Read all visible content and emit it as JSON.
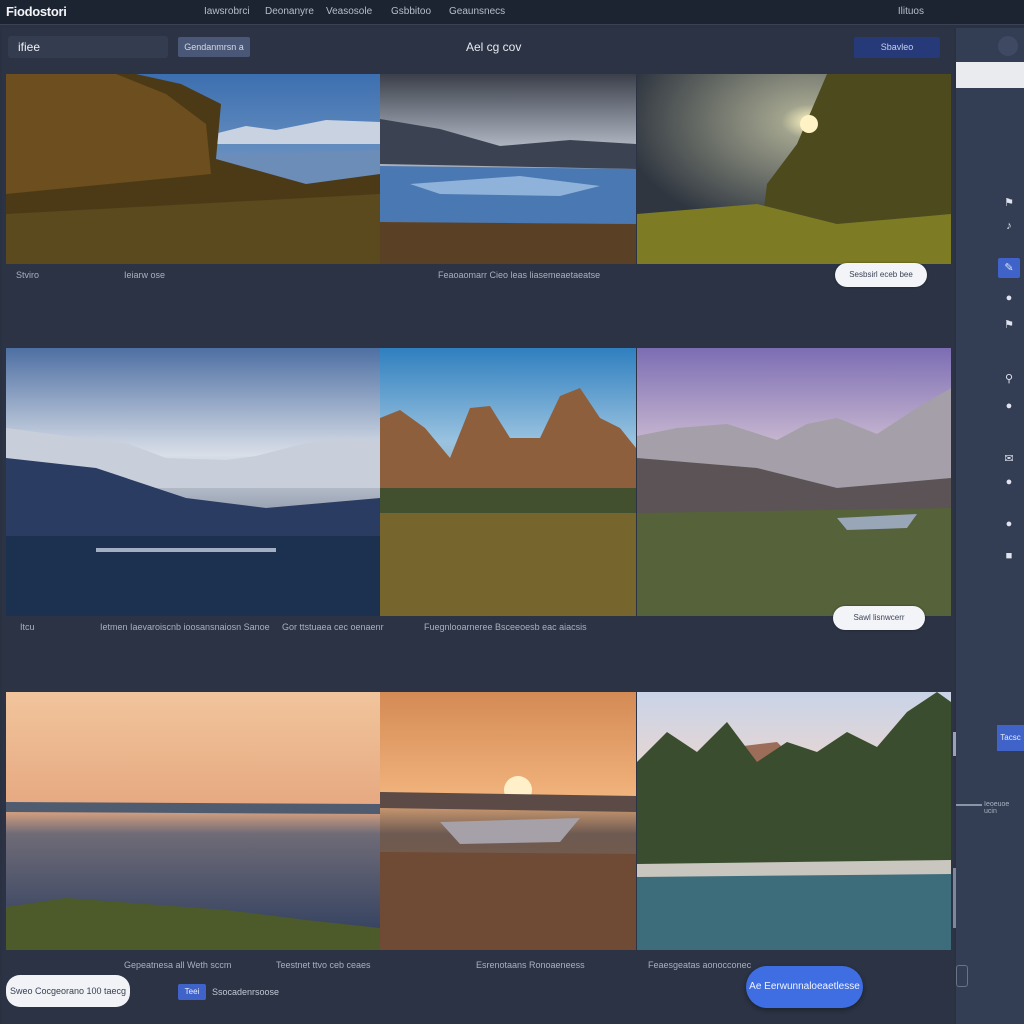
{
  "app": {
    "brand": "Fiodostori",
    "nav": [
      "Iawsrobrci",
      "Deonanyre",
      "Veasosole",
      "Gsbbitoo",
      "Geaunsnecs"
    ],
    "nav_right": "Ilituos"
  },
  "toolbar": {
    "search_value": "ifiee",
    "filter_label": "Gendanmrsn a",
    "title": "Ael cg cov",
    "primary_label": "Sbavleo"
  },
  "gallery": {
    "rows": [
      {
        "captions": [
          "Stviro",
          "Ieiarw ose",
          "Feaoaomarr Cieo leas liasemeaetaeatse"
        ],
        "pill": "Sesbsirl eceb bee"
      },
      {
        "captions": [
          "Itcu",
          "Ietmen Iaevaroiscnb ioosansnaiosn Sanoe",
          "Gor ttstuaea cec oenaenr",
          "Fuegnlooarneree Bsceeoesb eac aiacsis"
        ],
        "pill": "Sawl lisnwcerr"
      },
      {
        "captions": [
          "Gepeatnesa all Weth sccm",
          "Teestnet ttvo ceb ceaes",
          "Esrenotaans Ronoaeneess",
          "Feaesgeatas aonocconec"
        ],
        "pill": ""
      }
    ]
  },
  "sidebar": {
    "icons": [
      "tag-icon",
      "music-icon",
      "pen-icon",
      "globe-icon",
      "flag-icon",
      "pin-icon",
      "shield-icon",
      "mail-icon",
      "lock-icon",
      "chat-icon",
      "box-icon"
    ],
    "button_label": "Tacsc",
    "label": "Ieoeuoe ucin"
  },
  "footer": {
    "pill_label": "Sweo Cocgeorano 100 taecg",
    "tag_label": "Teei",
    "text": "Ssocadenrsoose",
    "cta_label": "Ae Eerwunnaloeaetlesse"
  }
}
